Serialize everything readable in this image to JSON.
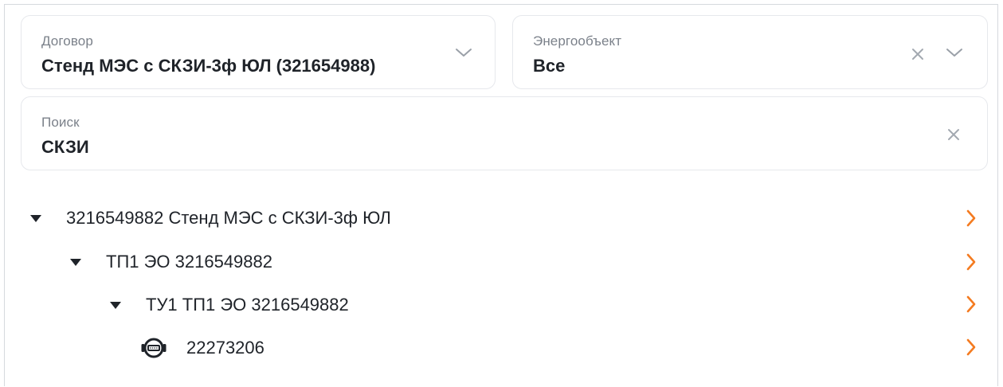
{
  "filters": {
    "contract": {
      "label": "Договор",
      "value": "Стенд МЭС с СКЗИ-3ф ЮЛ (321654988)"
    },
    "energy_object": {
      "label": "Энергообъект",
      "value": "Все"
    },
    "search": {
      "label": "Поиск",
      "value": "СКЗИ"
    }
  },
  "tree": {
    "nodes": [
      {
        "label": "3216549882 Стенд МЭС с СКЗИ-3ф ЮЛ",
        "level": 0,
        "expanded": true,
        "icon": "caret-down-icon"
      },
      {
        "label": "ТП1 ЭО 3216549882",
        "level": 1,
        "expanded": true,
        "icon": "caret-down-icon"
      },
      {
        "label": "ТУ1 ТП1 ЭО 3216549882",
        "level": 2,
        "expanded": true,
        "icon": "caret-down-icon"
      },
      {
        "label": "22273206",
        "level": 3,
        "icon": "meter-icon"
      }
    ]
  },
  "colors": {
    "accent": "#f47b20",
    "text": "#1f2329",
    "muted": "#7b818a",
    "border": "#e6e8ec"
  },
  "icons": {
    "dropdown": "chevron-down-icon",
    "clear": "close-icon",
    "row_action": "chevron-right-icon"
  }
}
